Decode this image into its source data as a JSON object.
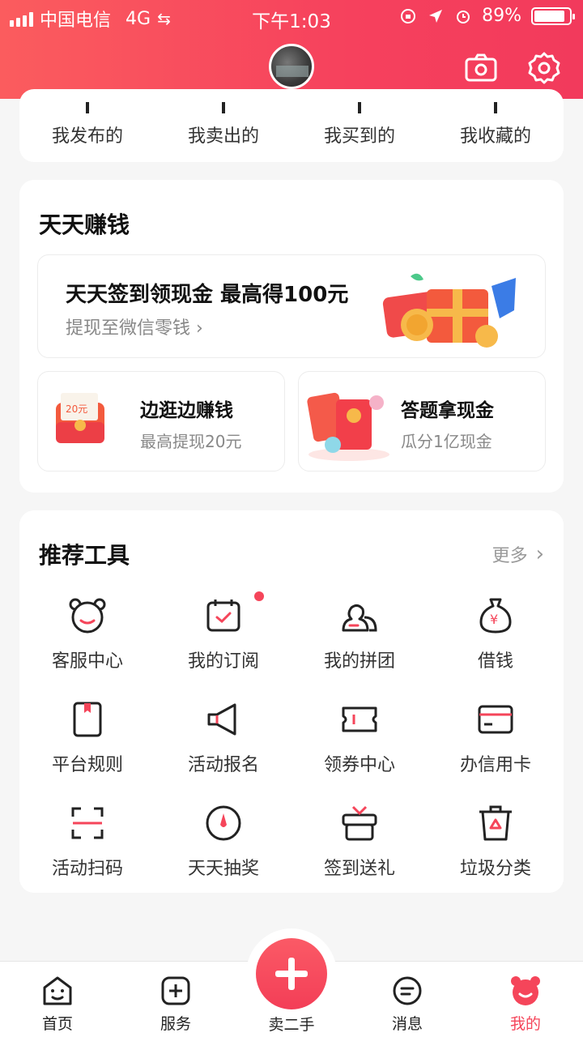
{
  "status_bar": {
    "carrier": "中国电信",
    "network": "4G",
    "time": "下午1:03",
    "battery_level": "89%",
    "battery_fraction": 0.89
  },
  "header": {
    "icons": [
      "camera-icon",
      "settings-icon"
    ]
  },
  "stats": [
    "我发布的",
    "我卖出的",
    "我买到的",
    "我收藏的"
  ],
  "earn": {
    "title": "天天赚钱",
    "banner": {
      "main": "天天签到领现金 最高得100元",
      "sub": "提现至微信零钱"
    },
    "cards": [
      {
        "name": "边逛边赚钱",
        "desc": "最高提现20元"
      },
      {
        "name": "答题拿现金",
        "desc": "瓜分1亿现金"
      }
    ]
  },
  "tools": {
    "title": "推荐工具",
    "more": "更多",
    "items": [
      {
        "label": "客服中心",
        "icon": "bear-face-icon"
      },
      {
        "label": "我的订阅",
        "icon": "calendar-check-icon",
        "badge": true
      },
      {
        "label": "我的拼团",
        "icon": "group-icon"
      },
      {
        "label": "借钱",
        "icon": "money-bag-icon"
      },
      {
        "label": "平台规则",
        "icon": "rulebook-icon"
      },
      {
        "label": "活动报名",
        "icon": "megaphone-icon"
      },
      {
        "label": "领券中心",
        "icon": "coupon-icon"
      },
      {
        "label": "办信用卡",
        "icon": "credit-card-icon"
      },
      {
        "label": "活动扫码",
        "icon": "scan-icon"
      },
      {
        "label": "天天抽奖",
        "icon": "lottery-icon"
      },
      {
        "label": "签到送礼",
        "icon": "gift-icon"
      },
      {
        "label": "垃圾分类",
        "icon": "recycle-bin-icon"
      }
    ]
  },
  "tabbar": {
    "items": [
      "首页",
      "服务",
      "卖二手",
      "消息",
      "我的"
    ],
    "active": "我的"
  },
  "colors": {
    "accent": "#f5455a",
    "header_gradient_start": "#fb5c5e",
    "header_gradient_end": "#f23a5c"
  }
}
